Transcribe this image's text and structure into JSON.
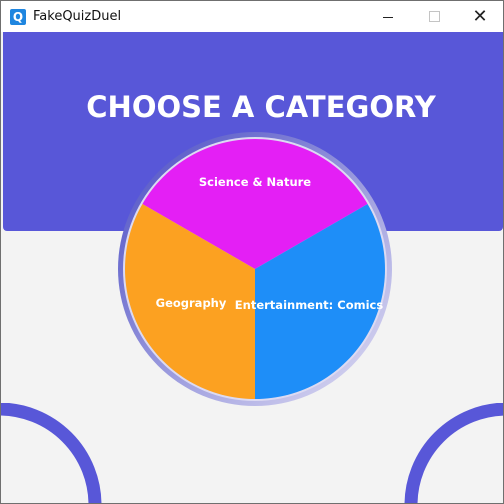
{
  "window": {
    "title": "FakeQuizDuel",
    "app_icon_glyph": "Q",
    "controls": [
      "minimize-icon",
      "maximize-icon",
      "close-icon"
    ],
    "close_glyph": "✕"
  },
  "header": {
    "title": "CHOOSE A CATEGORY",
    "band_color": "#5857d8"
  },
  "wheel": {
    "ring_color": "#c9c6ef",
    "categories": [
      {
        "label": "Science & Nature",
        "color": "#e41ff5"
      },
      {
        "label": "Entertainment: Comics",
        "color": "#1e8ef8"
      },
      {
        "label": "Geography",
        "color": "#fca121"
      }
    ]
  },
  "decor": {
    "corner_arc_color": "#5857d8"
  }
}
